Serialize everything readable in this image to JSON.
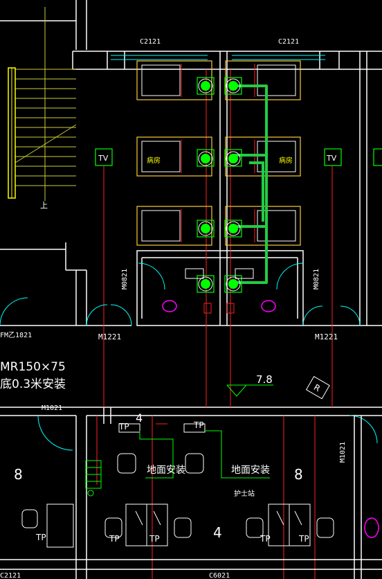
{
  "drawing": {
    "window_labels": {
      "top_left": "C2121",
      "top_right": "C2121",
      "bottom_left": "C2121",
      "bottom_mid": "C6021"
    },
    "tv_labels": {
      "left": "TV",
      "right": "TV"
    },
    "room_labels": {
      "ward_left": "病房",
      "ward_right": "病房"
    },
    "stair_up_label": "上",
    "door_labels": {
      "m0821_left": "M0821",
      "m0821_right": "M0821",
      "m1221_left": "M1221",
      "m1221_right": "M1221",
      "fm_left": "FM乙1821",
      "m1021_left": "M1021",
      "m1021_right": "M1021"
    },
    "spec_note": {
      "line1": "MR150×75",
      "line2": "底0.3米安装"
    },
    "elevation_mark": "7.8",
    "r_tag": "R",
    "lower_numbers": {
      "top_4": "4",
      "bottom_4": "4",
      "left_8": "8",
      "right_8": "8"
    },
    "floor_install": {
      "left": "地面安装",
      "right": "地面安装"
    },
    "nurse_station": "护士站",
    "tp_labels": {
      "tp_upper_1": "TP",
      "tp_upper_2": "TP",
      "tp_lower_1": "TP",
      "tp_lower_2": "TP",
      "tp_lower_3": "TP",
      "tp_lower_4": "TP",
      "tp_left": "TP"
    },
    "colors": {
      "wall": "#ffffff",
      "window": "#00ffff",
      "bed": "#ffff00",
      "bed_outline": "#ffcc33",
      "red_line": "#ff2020",
      "green_pipe": "#22cc44",
      "green_device": "#00ff00",
      "magenta": "#ff00ff",
      "door_arc": "#00ffff"
    }
  }
}
